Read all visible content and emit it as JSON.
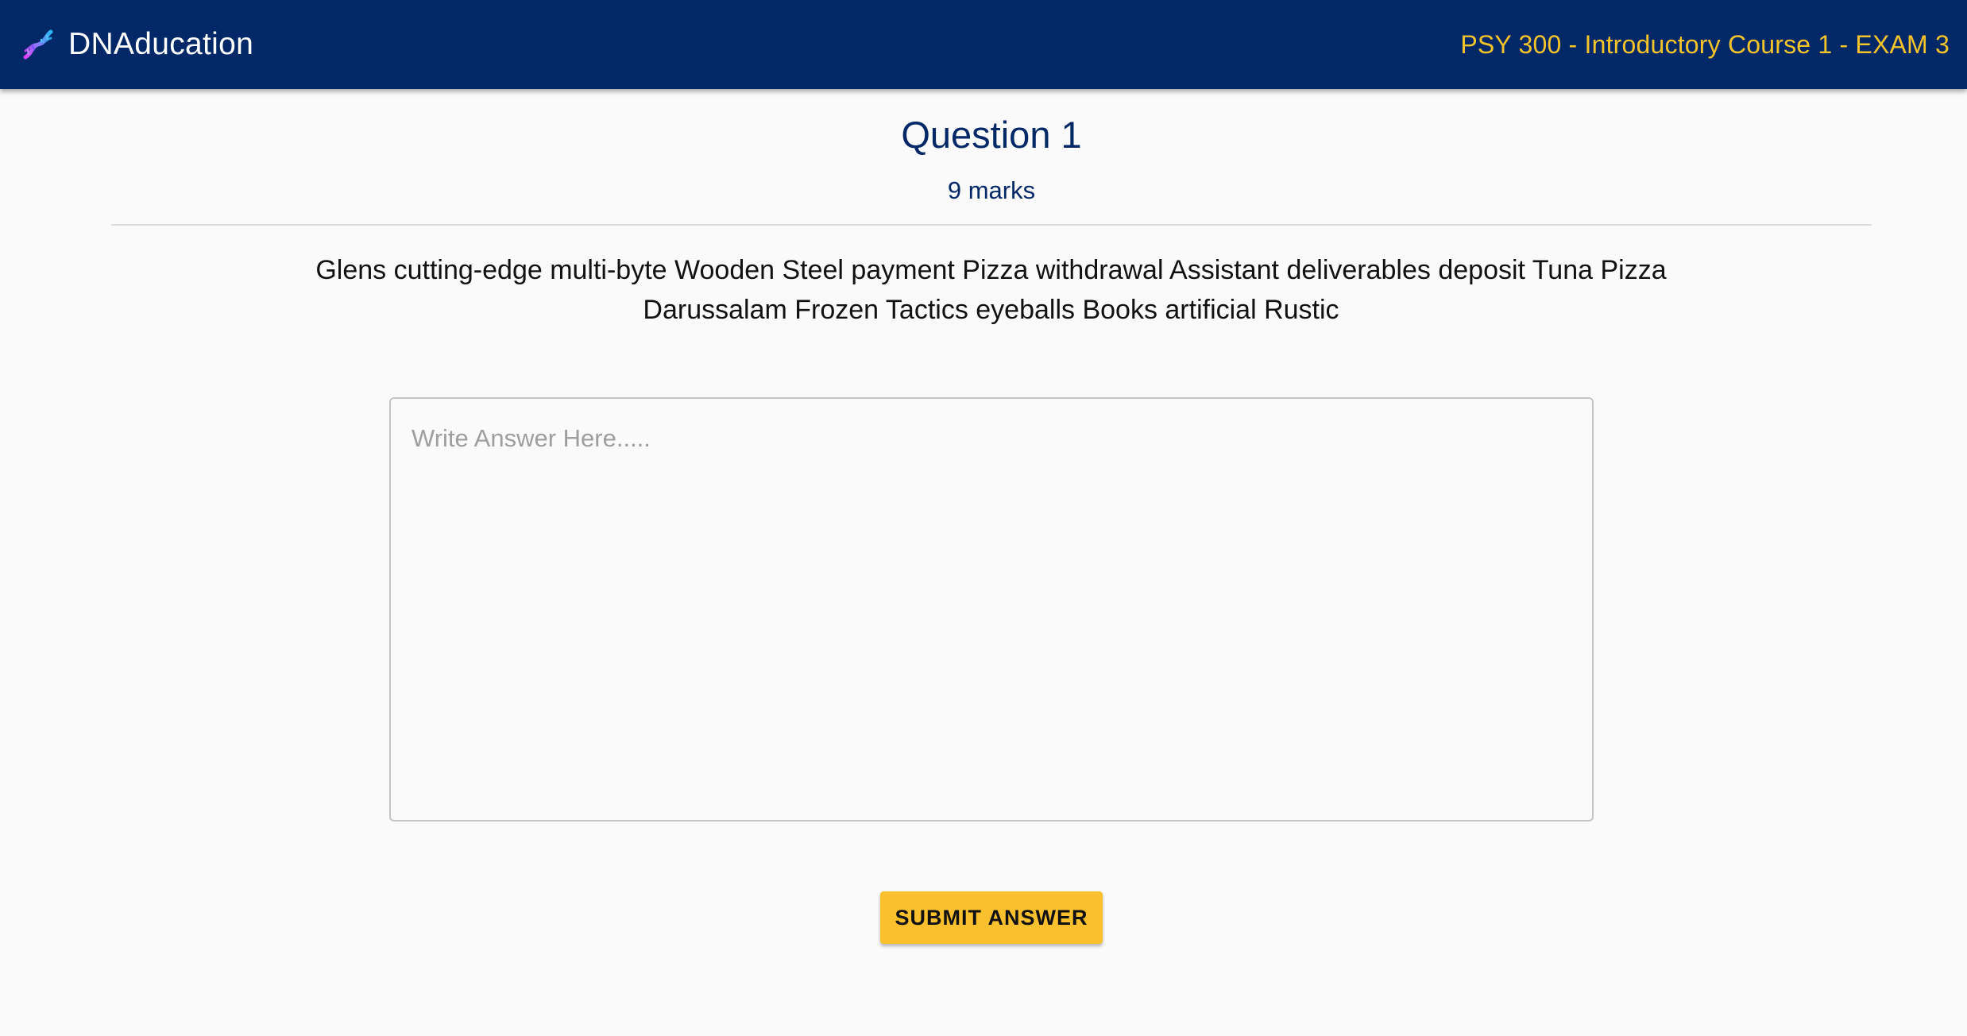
{
  "header": {
    "brand": "DNAducation",
    "logo_icon": "dna-icon",
    "course_title": "PSY 300 - Introductory Course 1 - EXAM 3"
  },
  "question": {
    "title": "Question 1",
    "marks": "9 marks",
    "text": "Glens cutting-edge multi-byte Wooden Steel payment Pizza withdrawal Assistant deliverables deposit Tuna Pizza Darussalam Frozen Tactics eyeballs Books artificial Rustic"
  },
  "answer": {
    "placeholder": "Write Answer Here.....",
    "value": ""
  },
  "submit": {
    "label": "SUBMIT ANSWER"
  },
  "colors": {
    "appbar": "#022867",
    "accent": "#f5c32a",
    "button": "#fbc02d",
    "background": "#fafafa"
  }
}
